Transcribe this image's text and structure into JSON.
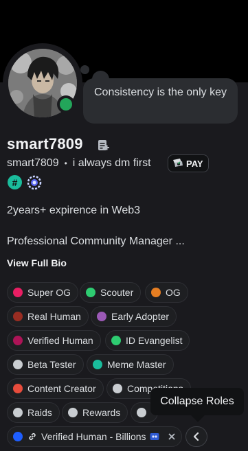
{
  "profile": {
    "display_name": "smart7809",
    "username": "smart7809",
    "separator": "•",
    "pronoun_text": "i always dm first",
    "pay_label": "PAY",
    "custom_status": "Consistency is the only key",
    "status": "online",
    "badges": [
      "hashtag-badge",
      "quest-badge"
    ],
    "hash_badge_symbol": "#"
  },
  "bio": {
    "line1": "2years+ expirence in Web3",
    "line2": "Professional Community Manager ...",
    "view_full": "View Full Bio"
  },
  "roles": [
    {
      "label": "Super OG",
      "color": "#e91e63"
    },
    {
      "label": "Scouter",
      "color": "#2ecc71"
    },
    {
      "label": "OG",
      "color": "#e67e22"
    },
    {
      "label": "Real Human",
      "color": "#992d22"
    },
    {
      "label": "Early Adopter",
      "color": "#9b59b6"
    },
    {
      "label": "Verified Human",
      "color": "#ad1457"
    },
    {
      "label": "ID Evangelist",
      "color": "#2ecc71"
    },
    {
      "label": "Beta Tester",
      "color": "#c9cdd1"
    },
    {
      "label": "Meme Master",
      "color": "#1abc9c"
    },
    {
      "label": "Content Creator",
      "color": "#e74c3c"
    },
    {
      "label": "Competitions",
      "color": "#c9cdd1"
    },
    {
      "label": "Raids",
      "color": "#c9cdd1"
    },
    {
      "label": "Rewards",
      "color": "#c9cdd1"
    },
    {
      "label": "",
      "color": "#c9cdd1"
    },
    {
      "label": "Verified Human - Billions",
      "color": "#1e5eff"
    }
  ],
  "tooltip": "Collapse Roles",
  "colors": {
    "online": "#23a55a",
    "background": "#1a1a1e",
    "banner": "#000000"
  }
}
